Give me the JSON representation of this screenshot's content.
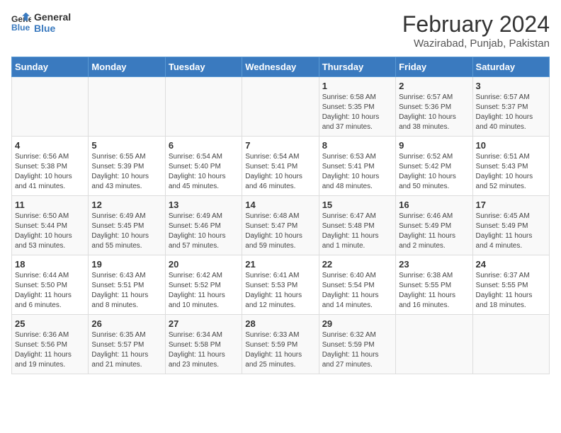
{
  "header": {
    "logo_line1": "General",
    "logo_line2": "Blue",
    "title": "February 2024",
    "subtitle": "Wazirabad, Punjab, Pakistan"
  },
  "days_of_week": [
    "Sunday",
    "Monday",
    "Tuesday",
    "Wednesday",
    "Thursday",
    "Friday",
    "Saturday"
  ],
  "weeks": [
    [
      {
        "day": "",
        "content": ""
      },
      {
        "day": "",
        "content": ""
      },
      {
        "day": "",
        "content": ""
      },
      {
        "day": "",
        "content": ""
      },
      {
        "day": "1",
        "content": "Sunrise: 6:58 AM\nSunset: 5:35 PM\nDaylight: 10 hours\nand 37 minutes."
      },
      {
        "day": "2",
        "content": "Sunrise: 6:57 AM\nSunset: 5:36 PM\nDaylight: 10 hours\nand 38 minutes."
      },
      {
        "day": "3",
        "content": "Sunrise: 6:57 AM\nSunset: 5:37 PM\nDaylight: 10 hours\nand 40 minutes."
      }
    ],
    [
      {
        "day": "4",
        "content": "Sunrise: 6:56 AM\nSunset: 5:38 PM\nDaylight: 10 hours\nand 41 minutes."
      },
      {
        "day": "5",
        "content": "Sunrise: 6:55 AM\nSunset: 5:39 PM\nDaylight: 10 hours\nand 43 minutes."
      },
      {
        "day": "6",
        "content": "Sunrise: 6:54 AM\nSunset: 5:40 PM\nDaylight: 10 hours\nand 45 minutes."
      },
      {
        "day": "7",
        "content": "Sunrise: 6:54 AM\nSunset: 5:41 PM\nDaylight: 10 hours\nand 46 minutes."
      },
      {
        "day": "8",
        "content": "Sunrise: 6:53 AM\nSunset: 5:41 PM\nDaylight: 10 hours\nand 48 minutes."
      },
      {
        "day": "9",
        "content": "Sunrise: 6:52 AM\nSunset: 5:42 PM\nDaylight: 10 hours\nand 50 minutes."
      },
      {
        "day": "10",
        "content": "Sunrise: 6:51 AM\nSunset: 5:43 PM\nDaylight: 10 hours\nand 52 minutes."
      }
    ],
    [
      {
        "day": "11",
        "content": "Sunrise: 6:50 AM\nSunset: 5:44 PM\nDaylight: 10 hours\nand 53 minutes."
      },
      {
        "day": "12",
        "content": "Sunrise: 6:49 AM\nSunset: 5:45 PM\nDaylight: 10 hours\nand 55 minutes."
      },
      {
        "day": "13",
        "content": "Sunrise: 6:49 AM\nSunset: 5:46 PM\nDaylight: 10 hours\nand 57 minutes."
      },
      {
        "day": "14",
        "content": "Sunrise: 6:48 AM\nSunset: 5:47 PM\nDaylight: 10 hours\nand 59 minutes."
      },
      {
        "day": "15",
        "content": "Sunrise: 6:47 AM\nSunset: 5:48 PM\nDaylight: 11 hours\nand 1 minute."
      },
      {
        "day": "16",
        "content": "Sunrise: 6:46 AM\nSunset: 5:49 PM\nDaylight: 11 hours\nand 2 minutes."
      },
      {
        "day": "17",
        "content": "Sunrise: 6:45 AM\nSunset: 5:49 PM\nDaylight: 11 hours\nand 4 minutes."
      }
    ],
    [
      {
        "day": "18",
        "content": "Sunrise: 6:44 AM\nSunset: 5:50 PM\nDaylight: 11 hours\nand 6 minutes."
      },
      {
        "day": "19",
        "content": "Sunrise: 6:43 AM\nSunset: 5:51 PM\nDaylight: 11 hours\nand 8 minutes."
      },
      {
        "day": "20",
        "content": "Sunrise: 6:42 AM\nSunset: 5:52 PM\nDaylight: 11 hours\nand 10 minutes."
      },
      {
        "day": "21",
        "content": "Sunrise: 6:41 AM\nSunset: 5:53 PM\nDaylight: 11 hours\nand 12 minutes."
      },
      {
        "day": "22",
        "content": "Sunrise: 6:40 AM\nSunset: 5:54 PM\nDaylight: 11 hours\nand 14 minutes."
      },
      {
        "day": "23",
        "content": "Sunrise: 6:38 AM\nSunset: 5:55 PM\nDaylight: 11 hours\nand 16 minutes."
      },
      {
        "day": "24",
        "content": "Sunrise: 6:37 AM\nSunset: 5:55 PM\nDaylight: 11 hours\nand 18 minutes."
      }
    ],
    [
      {
        "day": "25",
        "content": "Sunrise: 6:36 AM\nSunset: 5:56 PM\nDaylight: 11 hours\nand 19 minutes."
      },
      {
        "day": "26",
        "content": "Sunrise: 6:35 AM\nSunset: 5:57 PM\nDaylight: 11 hours\nand 21 minutes."
      },
      {
        "day": "27",
        "content": "Sunrise: 6:34 AM\nSunset: 5:58 PM\nDaylight: 11 hours\nand 23 minutes."
      },
      {
        "day": "28",
        "content": "Sunrise: 6:33 AM\nSunset: 5:59 PM\nDaylight: 11 hours\nand 25 minutes."
      },
      {
        "day": "29",
        "content": "Sunrise: 6:32 AM\nSunset: 5:59 PM\nDaylight: 11 hours\nand 27 minutes."
      },
      {
        "day": "",
        "content": ""
      },
      {
        "day": "",
        "content": ""
      }
    ]
  ]
}
